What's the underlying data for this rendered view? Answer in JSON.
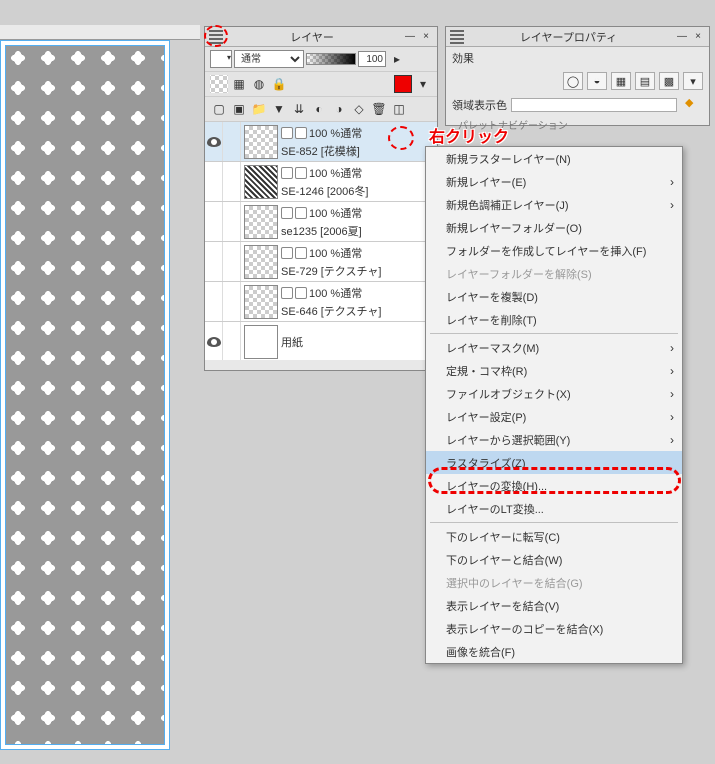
{
  "layers_panel": {
    "title": "レイヤー",
    "blend_mode": "通常",
    "blend_options": [
      "通常"
    ],
    "opacity": "100",
    "layers": [
      {
        "opacity_label": "100 %通常",
        "name": "SE-852 [花模様]",
        "selected": true,
        "visible": true,
        "thumb": "flower"
      },
      {
        "opacity_label": "100 %通常",
        "name": "SE-1246 [2006冬]",
        "selected": false,
        "visible": false,
        "thumb": "noise"
      },
      {
        "opacity_label": "100 %通常",
        "name": "se1235 [2006夏]",
        "selected": false,
        "visible": false,
        "thumb": "checker"
      },
      {
        "opacity_label": "100 %通常",
        "name": "SE-729 [テクスチャ]",
        "selected": false,
        "visible": false,
        "thumb": "checker"
      },
      {
        "opacity_label": "100 %通常",
        "name": "SE-646 [テクスチャ]",
        "selected": false,
        "visible": false,
        "thumb": "checker"
      },
      {
        "opacity_label": "",
        "name": "用紙",
        "selected": false,
        "visible": true,
        "thumb": "paper"
      }
    ]
  },
  "prop_panel": {
    "title": "レイヤープロパティ",
    "effect_label": "効果",
    "region_label": "領域表示色"
  },
  "nav_label": "パレットナビゲーション",
  "annotations": {
    "right_click": "右クリック"
  },
  "context_menu": {
    "items": [
      {
        "label": "新規ラスターレイヤー(N)",
        "type": "item"
      },
      {
        "label": "新規レイヤー(E)",
        "type": "sub"
      },
      {
        "label": "新規色調補正レイヤー(J)",
        "type": "sub"
      },
      {
        "label": "新規レイヤーフォルダー(O)",
        "type": "item"
      },
      {
        "label": "フォルダーを作成してレイヤーを挿入(F)",
        "type": "item"
      },
      {
        "label": "レイヤーフォルダーを解除(S)",
        "type": "disabled"
      },
      {
        "label": "レイヤーを複製(D)",
        "type": "item"
      },
      {
        "label": "レイヤーを削除(T)",
        "type": "item"
      },
      {
        "sep": true
      },
      {
        "label": "レイヤーマスク(M)",
        "type": "sub"
      },
      {
        "label": "定規・コマ枠(R)",
        "type": "sub"
      },
      {
        "label": "ファイルオブジェクト(X)",
        "type": "sub"
      },
      {
        "label": "レイヤー設定(P)",
        "type": "sub"
      },
      {
        "label": "レイヤーから選択範囲(Y)",
        "type": "sub"
      },
      {
        "label": "ラスタライズ(Z)",
        "type": "hov"
      },
      {
        "label": "レイヤーの変換(H)...",
        "type": "item"
      },
      {
        "label": "レイヤーのLT変換...",
        "type": "item"
      },
      {
        "sep": true
      },
      {
        "label": "下のレイヤーに転写(C)",
        "type": "item"
      },
      {
        "label": "下のレイヤーと結合(W)",
        "type": "item"
      },
      {
        "label": "選択中のレイヤーを結合(G)",
        "type": "disabled"
      },
      {
        "label": "表示レイヤーを結合(V)",
        "type": "item"
      },
      {
        "label": "表示レイヤーのコピーを結合(X)",
        "type": "item"
      },
      {
        "label": "画像を統合(F)",
        "type": "item"
      }
    ]
  }
}
